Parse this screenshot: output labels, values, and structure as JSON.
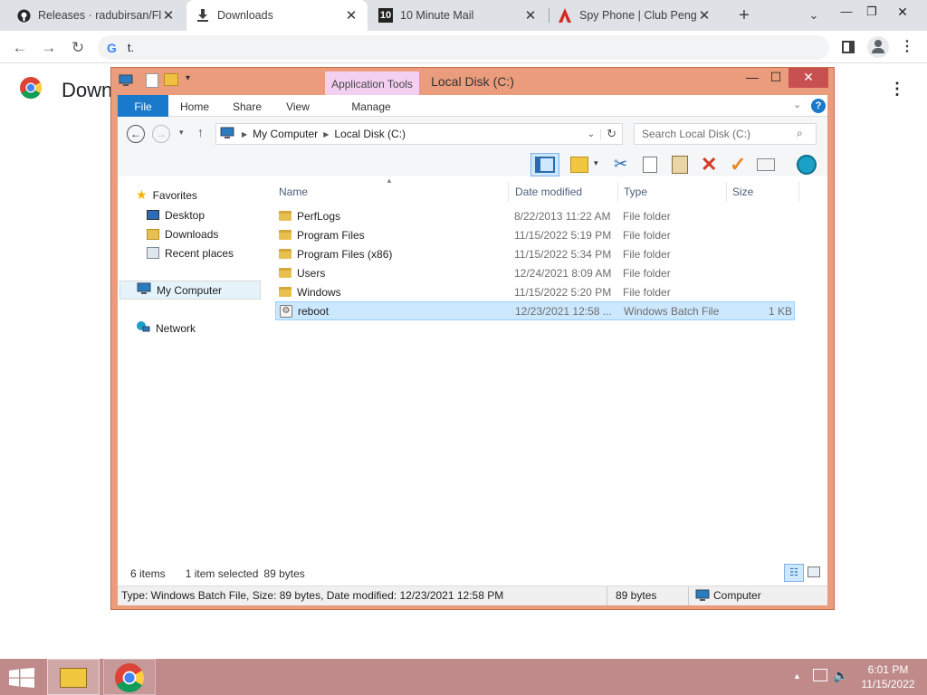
{
  "browser": {
    "tabs": [
      {
        "title": "Releases · radubirsan/Flat",
        "icon": "github-icon"
      },
      {
        "title": "Downloads",
        "icon": "download-icon"
      },
      {
        "title": "10 Minute Mail",
        "icon": "10minutemail-icon",
        "icon_text": "10"
      },
      {
        "title": "Spy Phone | Club Pengui",
        "icon": "club-penguin-icon"
      }
    ],
    "new_tab": "+",
    "omnibox_text": "t.",
    "page_heading": "Down"
  },
  "explorer": {
    "title": "Local Disk (C:)",
    "application_tools": "Application Tools",
    "ribbon_tabs": [
      "File",
      "Home",
      "Share",
      "View",
      "Manage"
    ],
    "breadcrumb": [
      "My Computer",
      "Local Disk (C:)"
    ],
    "search_placeholder": "Search Local Disk (C:)",
    "nav": {
      "favorites": "Favorites",
      "favorites_items": [
        "Desktop",
        "Downloads",
        "Recent places"
      ],
      "my_computer": "My Computer",
      "network": "Network"
    },
    "columns": [
      "Name",
      "Date modified",
      "Type",
      "Size"
    ],
    "files": [
      {
        "name": "PerfLogs",
        "date": "8/22/2013 11:22 AM",
        "type": "File folder",
        "size": ""
      },
      {
        "name": "Program Files",
        "date": "11/15/2022 5:19 PM",
        "type": "File folder",
        "size": ""
      },
      {
        "name": "Program Files (x86)",
        "date": "11/15/2022 5:34 PM",
        "type": "File folder",
        "size": ""
      },
      {
        "name": "Users",
        "date": "12/24/2021 8:09 AM",
        "type": "File folder",
        "size": ""
      },
      {
        "name": "Windows",
        "date": "11/15/2022 5:20 PM",
        "type": "File folder",
        "size": ""
      },
      {
        "name": "reboot",
        "date": "12/23/2021 12:58 ...",
        "type": "Windows Batch File",
        "size": "1 KB"
      }
    ],
    "status": {
      "items": "6 items",
      "selected": "1 item selected",
      "size": "89 bytes"
    },
    "details_bar": {
      "text": "Type: Windows Batch File, Size: 89 bytes, Date modified: 12/23/2021 12:58 PM",
      "size": "89 bytes",
      "location": "Computer"
    }
  },
  "taskbar": {
    "time": "6:01 PM",
    "date": "11/15/2022"
  }
}
